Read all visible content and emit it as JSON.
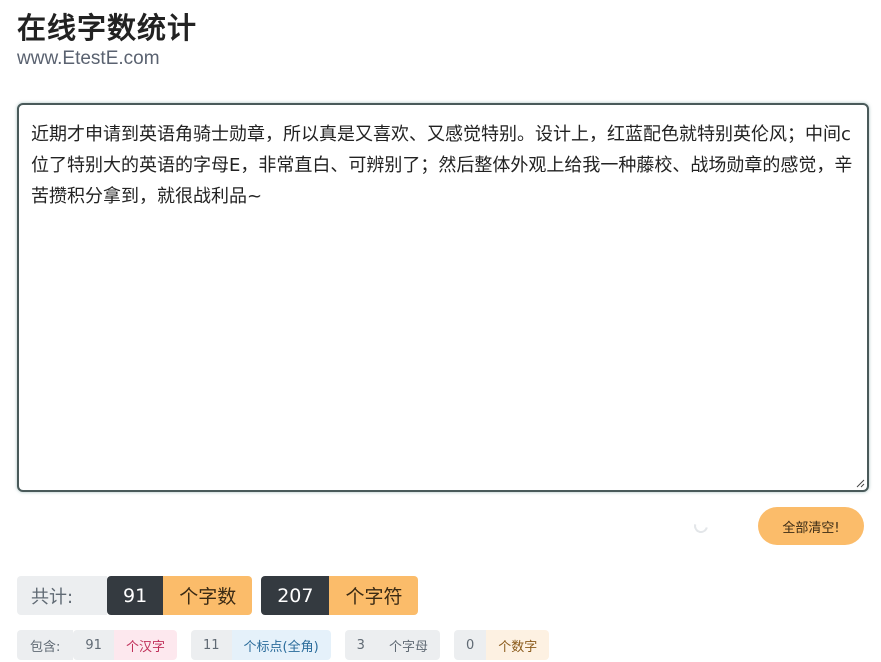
{
  "header": {
    "title": "在线字数统计",
    "subtitle": "www.EtestE.com"
  },
  "editor": {
    "text": "近期才申请到英语角骑士勋章，所以真是又喜欢、又感觉特别。设计上，红蓝配色就特别英伦风；中间c位了特别大的英语的字母E，非常直白、可辨别了；然后整体外观上给我一种藤校、战场勋章的感觉，辛苦攒积分拿到，就很战利品~"
  },
  "actions": {
    "clear_label": "全部清空!"
  },
  "totals": {
    "label": "共计:",
    "chars_count": "91",
    "chars_unit": "个字数",
    "symbols_count": "207",
    "symbols_unit": "个字符"
  },
  "breakdown": {
    "label": "包含:",
    "items": [
      {
        "count": "91",
        "unit": "个汉字"
      },
      {
        "count": "11",
        "unit": "个标点(全角)"
      },
      {
        "count": "3",
        "unit": "个字母"
      },
      {
        "count": "0",
        "unit": "个数字"
      }
    ]
  },
  "colors": {
    "accent": "#fbbc6a",
    "dark": "#343a40",
    "hanzi": "#c0305a",
    "punct": "#2b6c9b"
  }
}
